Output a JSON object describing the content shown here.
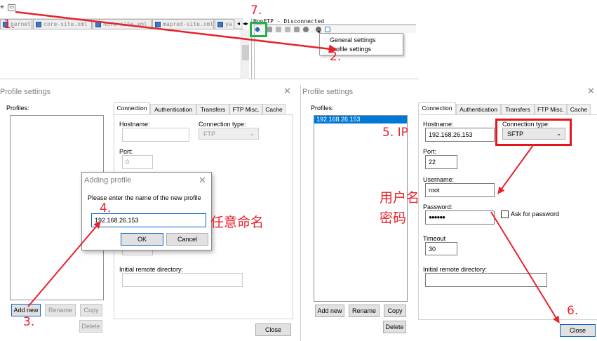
{
  "top": {
    "file_tabs": [
      "pernet.si.xml",
      "core-site.xml",
      "hdfs-site.xml",
      "mapred-site.xml",
      "ya"
    ],
    "ftp_title": "NppFTP - Disconnected",
    "menu": {
      "general_settings": "General settings",
      "profile_settings": "Profile settings"
    }
  },
  "dialog_left": {
    "title": "Profile settings",
    "profiles_label": "Profiles:",
    "tabs": [
      "Connection",
      "Authentication",
      "Transfers",
      "FTP Misc.",
      "Cache"
    ],
    "hostname_label": "Hostname:",
    "connection_type_label": "Connection type:",
    "connection_type_value": "FTP",
    "port_label": "Port:",
    "port_value": "0",
    "initial_dir_label": "Initial remote directory:",
    "buttons": {
      "add_new": "Add new",
      "rename": "Rename",
      "copy": "Copy",
      "delete": "Delete",
      "close": "Close"
    }
  },
  "adding_profile": {
    "title": "Adding profile",
    "prompt": "Please enter the name of the new profile",
    "value": "192.168.26.153",
    "ok": "OK",
    "cancel": "Cancel"
  },
  "dialog_right": {
    "title": "Profile settings",
    "profiles_label": "Profiles:",
    "profiles": [
      "192.168.26.153"
    ],
    "tabs": [
      "Connection",
      "Authentication",
      "Transfers",
      "FTP Misc.",
      "Cache"
    ],
    "hostname_label": "Hostname:",
    "hostname_value": "192.168.26.153",
    "connection_type_label": "Connection type:",
    "connection_type_value": "SFTP",
    "port_label": "Port:",
    "port_value": "22",
    "username_label": "Username:",
    "username_value": "root",
    "password_label": "Password:",
    "password_value": "●●●●●●",
    "ask_password_label": "Ask for password",
    "timeout_label": "Timeout",
    "timeout_value": "30",
    "initial_dir_label": "Initial remote directory:",
    "buttons": {
      "add_new": "Add new",
      "rename": "Rename",
      "copy": "Copy",
      "delete": "Delete",
      "close": "Close"
    }
  },
  "annotations": {
    "step1": "1.",
    "step2": "2.",
    "step3": "3.",
    "step4": "4.",
    "step5": "5. IP",
    "step6": "6.",
    "step7": "7.",
    "any_name": "任意命名",
    "username": "用户名",
    "password": "密码"
  },
  "colors": {
    "annotation_red": "#e8222b",
    "highlight_green": "#21b34b",
    "selection_blue": "#0078d7"
  }
}
